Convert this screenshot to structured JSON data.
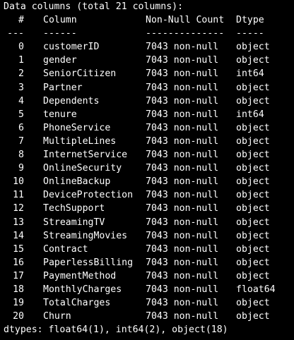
{
  "header": {
    "summary": "Data columns (total 21 columns):",
    "col_index": "#",
    "col_name": "Column",
    "col_count": "Non-Null Count",
    "col_dtype": "Dtype",
    "sep_index": "---",
    "sep_name": "------",
    "sep_count": "--------------",
    "sep_dtype": "-----"
  },
  "rows": [
    {
      "idx": "0",
      "name": "customerID",
      "count": "7043 non-null",
      "dtype": "object"
    },
    {
      "idx": "1",
      "name": "gender",
      "count": "7043 non-null",
      "dtype": "object"
    },
    {
      "idx": "2",
      "name": "SeniorCitizen",
      "count": "7043 non-null",
      "dtype": "int64"
    },
    {
      "idx": "3",
      "name": "Partner",
      "count": "7043 non-null",
      "dtype": "object"
    },
    {
      "idx": "4",
      "name": "Dependents",
      "count": "7043 non-null",
      "dtype": "object"
    },
    {
      "idx": "5",
      "name": "tenure",
      "count": "7043 non-null",
      "dtype": "int64"
    },
    {
      "idx": "6",
      "name": "PhoneService",
      "count": "7043 non-null",
      "dtype": "object"
    },
    {
      "idx": "7",
      "name": "MultipleLines",
      "count": "7043 non-null",
      "dtype": "object"
    },
    {
      "idx": "8",
      "name": "InternetService",
      "count": "7043 non-null",
      "dtype": "object"
    },
    {
      "idx": "9",
      "name": "OnlineSecurity",
      "count": "7043 non-null",
      "dtype": "object"
    },
    {
      "idx": "10",
      "name": "OnlineBackup",
      "count": "7043 non-null",
      "dtype": "object"
    },
    {
      "idx": "11",
      "name": "DeviceProtection",
      "count": "7043 non-null",
      "dtype": "object"
    },
    {
      "idx": "12",
      "name": "TechSupport",
      "count": "7043 non-null",
      "dtype": "object"
    },
    {
      "idx": "13",
      "name": "StreamingTV",
      "count": "7043 non-null",
      "dtype": "object"
    },
    {
      "idx": "14",
      "name": "StreamingMovies",
      "count": "7043 non-null",
      "dtype": "object"
    },
    {
      "idx": "15",
      "name": "Contract",
      "count": "7043 non-null",
      "dtype": "object"
    },
    {
      "idx": "16",
      "name": "PaperlessBilling",
      "count": "7043 non-null",
      "dtype": "object"
    },
    {
      "idx": "17",
      "name": "PaymentMethod",
      "count": "7043 non-null",
      "dtype": "object"
    },
    {
      "idx": "18",
      "name": "MonthlyCharges",
      "count": "7043 non-null",
      "dtype": "float64"
    },
    {
      "idx": "19",
      "name": "TotalCharges",
      "count": "7043 non-null",
      "dtype": "object"
    },
    {
      "idx": "20",
      "name": "Churn",
      "count": "7043 non-null",
      "dtype": "object"
    }
  ],
  "footer": {
    "dtypes": "dtypes: float64(1), int64(2), object(18)"
  },
  "colors": {
    "background": "#000000",
    "text": "#ffffff"
  }
}
